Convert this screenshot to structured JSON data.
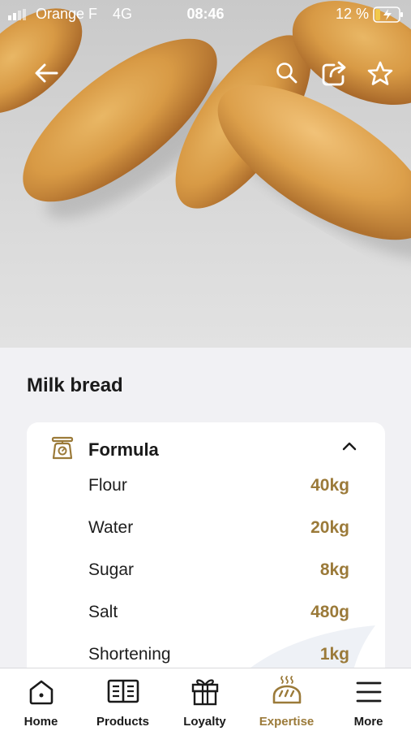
{
  "status_bar": {
    "carrier": "Orange F",
    "network": "4G",
    "time": "08:46",
    "battery_percent": "12 %"
  },
  "header": {
    "back_icon": "arrow-left-icon",
    "search_icon": "search-icon",
    "share_icon": "share-icon",
    "favorite_icon": "star-icon"
  },
  "recipe": {
    "title": "Milk bread"
  },
  "formula": {
    "label": "Formula",
    "icon": "scale-icon",
    "expanded": true,
    "ingredients": [
      {
        "name": "Flour",
        "qty": "40kg"
      },
      {
        "name": "Water",
        "qty": "20kg"
      },
      {
        "name": "Sugar",
        "qty": "8kg"
      },
      {
        "name": "Salt",
        "qty": "480g"
      },
      {
        "name": "Shortening",
        "qty": "1kg"
      }
    ]
  },
  "tabs": [
    {
      "label": "Home",
      "icon": "home-icon",
      "active": false
    },
    {
      "label": "Products",
      "icon": "products-book-icon",
      "active": false
    },
    {
      "label": "Loyalty",
      "icon": "gift-icon",
      "active": false
    },
    {
      "label": "Expertise",
      "icon": "bread-icon",
      "active": true
    },
    {
      "label": "More",
      "icon": "menu-icon",
      "active": false
    }
  ],
  "colors": {
    "accent": "#9b7a39",
    "text": "#1a1a1a",
    "background": "#f1f1f4"
  }
}
